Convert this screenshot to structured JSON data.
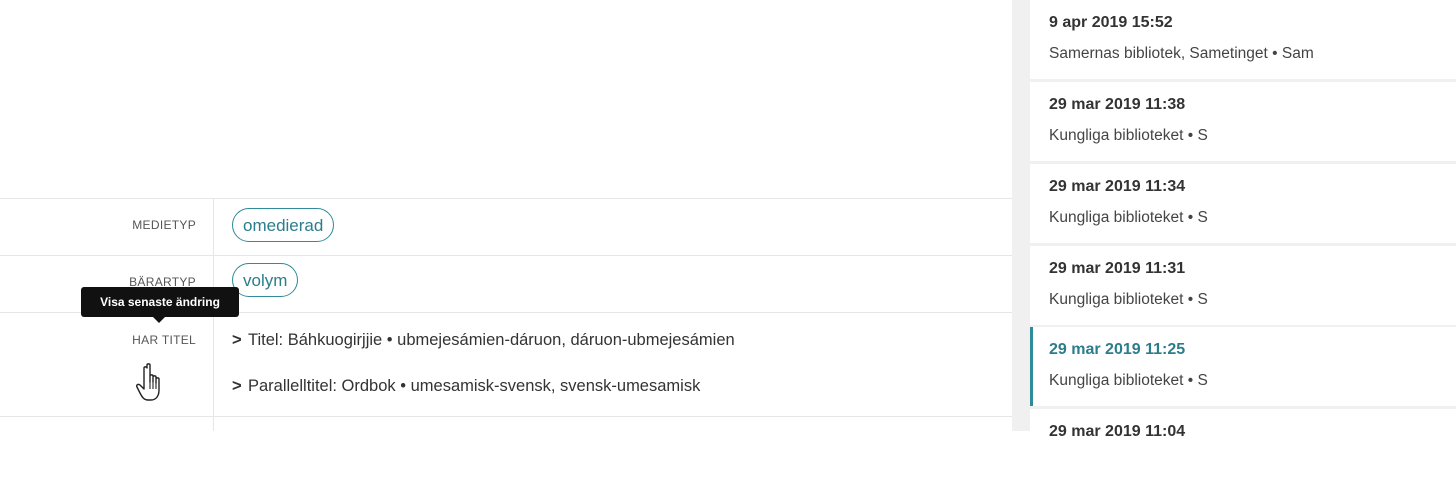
{
  "form": {
    "rows": [
      {
        "label": "MEDIETYP",
        "value": "omedierad"
      },
      {
        "label": "BÄRARTYP",
        "value": "volym"
      }
    ],
    "har_titel": {
      "label": "HAR TITEL",
      "items": [
        "Titel: Báhkuogirjjie • ubmejesámien-dáruon, dáruon-ubmejesámien",
        "Parallelltitel: Ordbok • umesamisk-svensk, svensk-umesamisk"
      ]
    },
    "tooltip": "Visa senaste ändring",
    "chevron": ">"
  },
  "history": {
    "entries": [
      {
        "date": "9 apr 2019 15:52",
        "who": "Samernas bibliotek, Sametinget • Sam",
        "active": false
      },
      {
        "date": "29 mar 2019 11:38",
        "who": "Kungliga biblioteket • S",
        "active": false
      },
      {
        "date": "29 mar 2019 11:34",
        "who": "Kungliga biblioteket • S",
        "active": false
      },
      {
        "date": "29 mar 2019 11:31",
        "who": "Kungliga biblioteket • S",
        "active": false
      },
      {
        "date": "29 mar 2019 11:25",
        "who": "Kungliga biblioteket • S",
        "active": true
      },
      {
        "date": "29 mar 2019 11:04",
        "who": "",
        "active": false
      }
    ]
  },
  "colors": {
    "accent": "#2f8a9a",
    "tooltip_bg": "#111111",
    "panel_bg": "#f0f0f0"
  },
  "icons": {
    "cursor": "hand-pointer-icon",
    "chevron": "chevron-right-icon"
  }
}
